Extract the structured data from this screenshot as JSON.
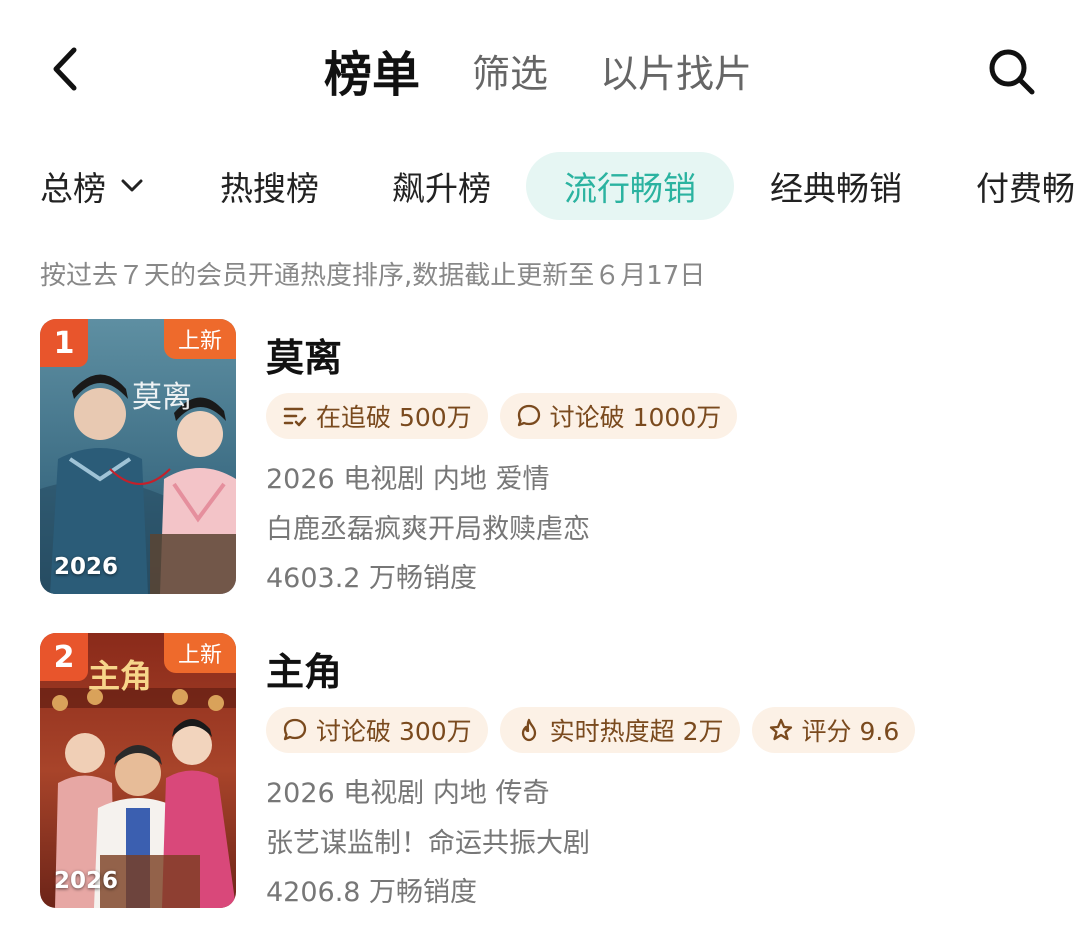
{
  "header": {
    "tabs": [
      {
        "label": "榜单",
        "active": true
      },
      {
        "label": "筛选",
        "active": false
      },
      {
        "label": "以片找片",
        "active": false
      }
    ],
    "back_icon": "chevron-left-icon",
    "search_icon": "search-icon"
  },
  "categories": [
    {
      "label": "总榜",
      "has_dropdown": true
    },
    {
      "label": "热搜榜"
    },
    {
      "label": "飙升榜"
    },
    {
      "label": "流行畅销",
      "active": true
    },
    {
      "label": "经典畅销"
    },
    {
      "label": "付费畅"
    }
  ],
  "note": "按过去７天的会员开通热度排序,数据截止更新至６月17日",
  "colors": {
    "accent": "#2bb3a0",
    "accent_bg": "#e6f6f3",
    "rank": "#e8552c",
    "badge_bg": "#fcf1e6",
    "badge_text": "#7a4a1e"
  },
  "items": [
    {
      "rank": "1",
      "new_tag": "上新",
      "year": "2026",
      "poster_text": "莫离",
      "title": "莫离",
      "badges": [
        {
          "icon": "list-check-icon",
          "text": "在追破 500万"
        },
        {
          "icon": "chat-bubble-icon",
          "text": "讨论破 1000万"
        }
      ],
      "meta": "2026 电视剧 内地 爱情",
      "desc": "白鹿丞磊疯爽开局救赎虐恋",
      "sales": "4603.2 万畅销度"
    },
    {
      "rank": "2",
      "new_tag": "上新",
      "year": "2026",
      "poster_text": "主角",
      "title": "主角",
      "badges": [
        {
          "icon": "chat-bubble-icon",
          "text": "讨论破 300万"
        },
        {
          "icon": "flame-icon",
          "text": "实时热度超 2万"
        },
        {
          "icon": "star-icon",
          "text": "评分 9.6"
        }
      ],
      "meta": "2026 电视剧 内地 传奇",
      "desc": "张艺谋监制！命运共振大剧",
      "sales": "4206.8 万畅销度"
    }
  ]
}
